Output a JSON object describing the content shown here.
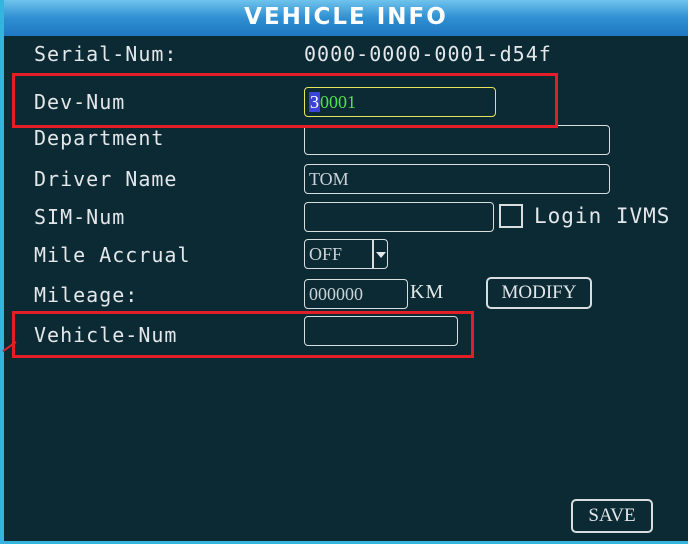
{
  "title": "VEHICLE INFO",
  "rows": {
    "serial": {
      "label": "Serial-Num:",
      "value": "0000-0000-0001-d54f"
    },
    "dev": {
      "label": "Dev-Num",
      "value_cursor": "3",
      "value_rest": "0001"
    },
    "department": {
      "label": "Department",
      "value": ""
    },
    "driver": {
      "label": "Driver Name",
      "value": "TOM"
    },
    "sim": {
      "label": "SIM-Num",
      "value": "",
      "checkbox_label": "Login IVMS",
      "checkbox_checked": false
    },
    "mile_accrual": {
      "label": "Mile Accrual",
      "value": "OFF"
    },
    "mileage": {
      "label": "Mileage:",
      "value": "000000",
      "unit": "KM",
      "modify_label": "MODIFY"
    },
    "vehicle": {
      "label": "Vehicle-Num",
      "value": ""
    }
  },
  "save_label": "SAVE",
  "colors": {
    "background": "#0b2a33",
    "title_gradient_top": "#6fc3ec",
    "title_gradient_bottom": "#1f77c2",
    "highlight": "#e41e26",
    "cursor": "#3b43d8",
    "dev_text": "#4fe24f"
  }
}
